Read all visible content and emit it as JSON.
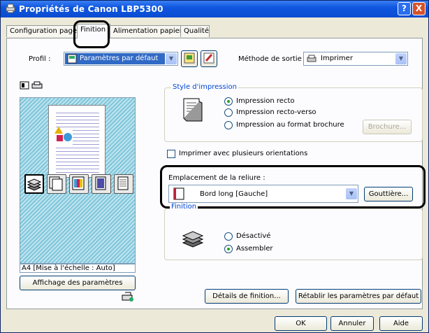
{
  "window": {
    "title": "Propriétés de Canon LBP5300",
    "help": "?",
    "close": "X"
  },
  "tabs": [
    "Configuration page",
    "Finition",
    "Alimentation papier",
    "Qualité"
  ],
  "profile": {
    "label": "Profil :",
    "value": "Paramètres par défaut"
  },
  "output": {
    "label": "Méthode de sortie :",
    "value": "Imprimer"
  },
  "preview": {
    "caption": "A4 [Mise à l'échelle : Auto]",
    "button": "Affichage des paramètres"
  },
  "print_style": {
    "title": "Style d'impression",
    "options": [
      "Impression recto",
      "Impression recto-verso",
      "Impression au format brochure"
    ],
    "selected": 0,
    "brochure_button": "Brochure..."
  },
  "mixed_orientation": {
    "label": "Imprimer avec plusieurs orientations",
    "checked": false
  },
  "binding": {
    "label": "Emplacement de la reliure :",
    "value": "Bord long [Gauche]",
    "gutter_button": "Gouttière..."
  },
  "finishing": {
    "title": "Finition",
    "options": [
      "Désactivé",
      "Assembler"
    ],
    "selected": 1
  },
  "footer_buttons": {
    "details": "Détails de finition...",
    "restore": "Rétablir les paramètres par défaut"
  },
  "dialog_buttons": {
    "ok": "OK",
    "cancel": "Annuler",
    "help": "Aide"
  },
  "colors": {
    "title_bar": "#0f56e0",
    "highlight": "#000000",
    "group_title": "#0046d5",
    "radio_on": "#21a121"
  },
  "icons": [
    "printer-icon",
    "profile-card-icon",
    "add-profile-icon",
    "edit-profile-icon",
    "page-view-icon",
    "printer-settings-icon",
    "document-icon",
    "binding-edge-icon",
    "collate-icon",
    "page-settings-icon"
  ]
}
